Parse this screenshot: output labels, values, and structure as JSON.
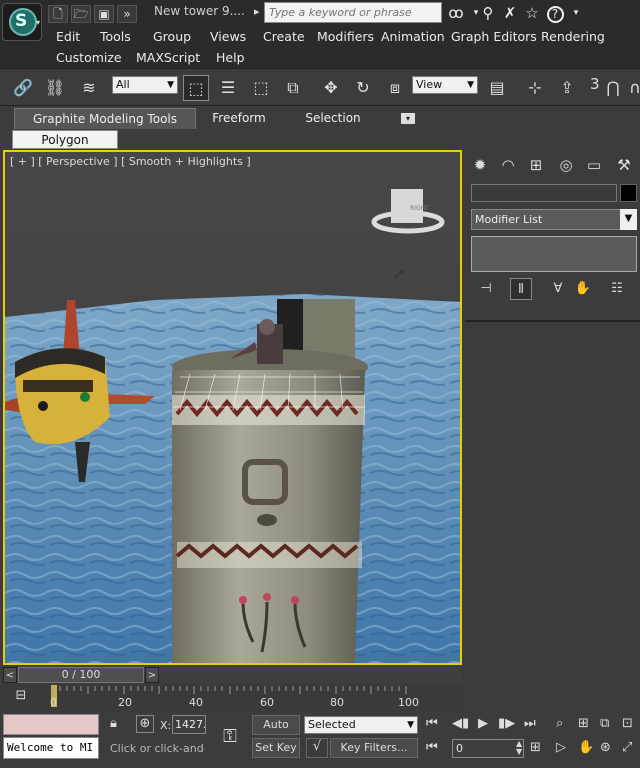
{
  "window": {
    "title": "New tower 9...."
  },
  "quick_access": {
    "new_icon": "new-file-icon",
    "open_icon": "open-folder-icon",
    "save_icon": "save-icon",
    "more_icon": "more-icon"
  },
  "search": {
    "placeholder": "Type a keyword or phrase"
  },
  "menu": {
    "row1": [
      "Edit",
      "Tools",
      "Group",
      "Views",
      "Create",
      "Modifiers",
      "Animation",
      "Graph Editors",
      "Rendering"
    ],
    "row2": [
      "Customize",
      "MAXScript",
      "Help"
    ]
  },
  "toolbar": {
    "selection_filter": "All",
    "ref_coord": "View",
    "snap_label": "3"
  },
  "ribbon": {
    "tabs": [
      "Graphite Modeling Tools",
      "Freeform",
      "Selection"
    ],
    "subtab": "Polygon Modeling"
  },
  "viewport": {
    "label": "[ + ] [ Perspective ] [ Smooth + Highlights ]",
    "viewcube_face": "RIGHT"
  },
  "command_panel": {
    "modifier_list": "Modifier List"
  },
  "time_slider": {
    "position": "0 / 100",
    "left_arrow": "<",
    "right_arrow": ">",
    "ticks": [
      "0",
      "20",
      "40",
      "60",
      "80",
      "100"
    ]
  },
  "status": {
    "maxscript_text": "Welcome to MI",
    "prompt": "Click or click-and-dr",
    "x_label": "X:",
    "x_value": "1427.",
    "auto_key": "Auto Key",
    "set_key": "Set Key",
    "selected": "Selected",
    "key_filters": "Key Filters...",
    "frame": "0"
  }
}
